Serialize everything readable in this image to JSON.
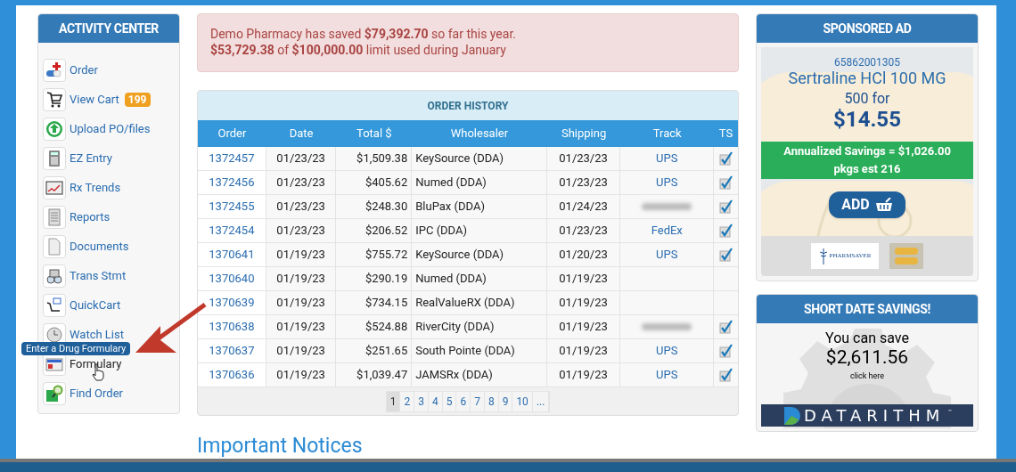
{
  "activity_center": {
    "title": "ACTIVITY CENTER",
    "items": [
      {
        "label": "Order",
        "hovered": false
      },
      {
        "label": "View Cart",
        "badge": "199",
        "hovered": false
      },
      {
        "label": "Upload PO/files",
        "hovered": false
      },
      {
        "label": "EZ Entry",
        "hovered": false
      },
      {
        "label": "Rx Trends",
        "hovered": false
      },
      {
        "label": "Reports",
        "hovered": false
      },
      {
        "label": "Documents",
        "hovered": false
      },
      {
        "label": "Trans Stmt",
        "hovered": false
      },
      {
        "label": "QuickCart",
        "hovered": false
      },
      {
        "label": "Watch List",
        "hovered": false
      },
      {
        "label": "Formulary",
        "hovered": true,
        "tooltip": "Enter a Drug Formulary"
      },
      {
        "label": "Find Order",
        "hovered": false
      }
    ]
  },
  "savings_alert": {
    "lines": [
      "Demo Pharmacy has saved **$79,392.70** so far this year.",
      "**$53,729.38** of **$100,000.00** limit used during January"
    ]
  },
  "order_history": {
    "title": "ORDER HISTORY",
    "columns": [
      "Order",
      "Date",
      "Total $",
      "Wholesaler",
      "Shipping",
      "Track",
      "TS"
    ],
    "rows": [
      {
        "order": "1372457",
        "date": "01/23/23",
        "total": "$1,509.38",
        "wholesaler": "KeySource (DDA)",
        "shipping": "01/23/23",
        "track": "UPS",
        "ts": true
      },
      {
        "order": "1372456",
        "date": "01/23/23",
        "total": "$405.62",
        "wholesaler": "Numed (DDA)",
        "shipping": "01/23/23",
        "track": "UPS",
        "ts": true
      },
      {
        "order": "1372455",
        "date": "01/23/23",
        "total": "$248.30",
        "wholesaler": "BluPax (DDA)",
        "shipping": "01/24/23",
        "track_redacted": true,
        "ts": true
      },
      {
        "order": "1372454",
        "date": "01/23/23",
        "total": "$206.52",
        "wholesaler": "IPC (DDA)",
        "shipping": "01/23/23",
        "track": "FedEx",
        "ts": true
      },
      {
        "order": "1370641",
        "date": "01/19/23",
        "total": "$755.72",
        "wholesaler": "KeySource (DDA)",
        "shipping": "01/20/23",
        "track": "UPS",
        "ts": true
      },
      {
        "order": "1370640",
        "date": "01/19/23",
        "total": "$290.19",
        "wholesaler": "Numed (DDA)",
        "shipping": "01/19/23",
        "ts": false
      },
      {
        "order": "1370639",
        "date": "01/19/23",
        "total": "$734.15",
        "wholesaler": "RealValueRX (DDA)",
        "shipping": "01/19/23",
        "ts": false
      },
      {
        "order": "1370638",
        "date": "01/19/23",
        "total": "$524.88",
        "wholesaler": "RiverCity (DDA)",
        "shipping": "01/19/23",
        "track_redacted": true,
        "ts": true
      },
      {
        "order": "1370637",
        "date": "01/19/23",
        "total": "$251.65",
        "wholesaler": "South Pointe (DDA)",
        "shipping": "01/19/23",
        "track": "UPS",
        "ts": true
      },
      {
        "order": "1370636",
        "date": "01/19/23",
        "total": "$1,039.47",
        "wholesaler": "JAMSRx (DDA)",
        "shipping": "01/19/23",
        "track": "UPS",
        "ts": true
      }
    ],
    "pages": [
      {
        "label": "1",
        "selected": true
      },
      {
        "label": "2",
        "selected": false
      },
      {
        "label": "3",
        "selected": false
      },
      {
        "label": "4",
        "selected": false
      },
      {
        "label": "5",
        "selected": false
      },
      {
        "label": "6",
        "selected": false
      },
      {
        "label": "7",
        "selected": false
      },
      {
        "label": "8",
        "selected": false
      },
      {
        "label": "9",
        "selected": false
      },
      {
        "label": "10",
        "selected": false
      },
      {
        "label": "...",
        "selected": false
      }
    ]
  },
  "notices": {
    "title": "Important Notices"
  },
  "sponsored_ad": {
    "title": "SPONSORED AD",
    "ndc": "65862001305",
    "drug": "Sertraline HCl 100 MG",
    "quantity": "500 for",
    "price": "$14.55",
    "savings": "Annualized Savings = $1,026.00",
    "packages": "pkgs est 216",
    "button": "ADD",
    "vendor_logo": "PHARMSAVER"
  },
  "short_date": {
    "title": "SHORT DATE SAVINGS!",
    "lead": "You can save",
    "amount": "$2,611.56",
    "link": "click here",
    "brand": "DATARITHM",
    "trademark": "™"
  }
}
